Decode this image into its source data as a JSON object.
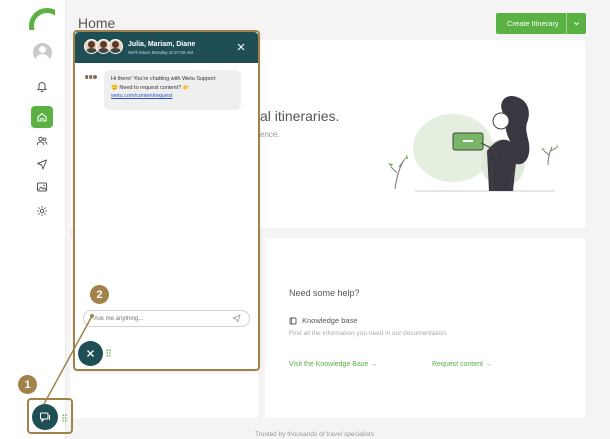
{
  "header": {
    "title": "Home",
    "create_button_label": "Create Itinerary"
  },
  "sidebar": {
    "items": [
      {
        "name": "notifications",
        "icon": "bell-icon"
      },
      {
        "name": "home",
        "icon": "home-icon",
        "active": true
      },
      {
        "name": "contacts",
        "icon": "users-icon"
      },
      {
        "name": "send",
        "icon": "send-icon"
      },
      {
        "name": "media",
        "icon": "image-icon"
      },
      {
        "name": "settings",
        "icon": "gear-icon"
      }
    ]
  },
  "hero": {
    "heading_visible": "al itineraries.",
    "subtext_visible": "ence."
  },
  "help": {
    "title": "Need some help?",
    "knowledge_base_label": "Knowledge base",
    "knowledge_base_desc": "Find all the information you need in our documentation.",
    "visit_link": "Visit the Knowledge Base →",
    "request_link": "Request content →"
  },
  "footer": {
    "note": "Trusted by thousands of travel specialists"
  },
  "chat": {
    "agents": "Julia, Mariam, Diane",
    "status": "We'll return Monday at 07:00 AM",
    "message_line1": "Hi there! You're chatting with Wetu Support",
    "message_line2": "🙂 Need to request content? 👉",
    "message_link": "wetu.com/contentrequest",
    "input_placeholder": "Ask me anything..."
  },
  "annotations": {
    "step1": "1",
    "step2": "2"
  },
  "colors": {
    "brand_green": "#5bb143",
    "chat_teal": "#1f4f55",
    "annotation_gold": "#a0824a"
  }
}
